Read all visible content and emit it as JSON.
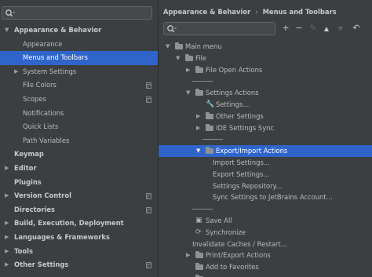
{
  "left": {
    "search": {
      "value": ""
    },
    "items": [
      {
        "label": "Appearance & Behavior",
        "bold": true,
        "arrow": "down"
      },
      {
        "label": "Appearance",
        "bold": false,
        "arrow": ""
      },
      {
        "label": "Menus and Toolbars",
        "bold": false,
        "arrow": "",
        "selected": true
      },
      {
        "label": "System Settings",
        "bold": false,
        "arrow": "right"
      },
      {
        "label": "File Colors",
        "bold": false,
        "arrow": "",
        "copy": true
      },
      {
        "label": "Scopes",
        "bold": false,
        "arrow": "",
        "copy": true
      },
      {
        "label": "Notifications",
        "bold": false,
        "arrow": ""
      },
      {
        "label": "Quick Lists",
        "bold": false,
        "arrow": ""
      },
      {
        "label": "Path Variables",
        "bold": false,
        "arrow": ""
      },
      {
        "label": "Keymap",
        "bold": true,
        "arrow": ""
      },
      {
        "label": "Editor",
        "bold": true,
        "arrow": "right"
      },
      {
        "label": "Plugins",
        "bold": true,
        "arrow": ""
      },
      {
        "label": "Version Control",
        "bold": true,
        "arrow": "right",
        "copy": true
      },
      {
        "label": "Directories",
        "bold": true,
        "arrow": "",
        "copy": true
      },
      {
        "label": "Build, Execution, Deployment",
        "bold": true,
        "arrow": "right"
      },
      {
        "label": "Languages & Frameworks",
        "bold": true,
        "arrow": "right"
      },
      {
        "label": "Tools",
        "bold": true,
        "arrow": "right"
      },
      {
        "label": "Other Settings",
        "bold": true,
        "arrow": "right",
        "copy": true
      }
    ]
  },
  "right": {
    "breadcrumb": [
      "Appearance & Behavior",
      "Menus and Toolbars"
    ],
    "search": {
      "value": ""
    },
    "toolbar": [
      {
        "name": "add-button",
        "glyph": "+",
        "enabled": true
      },
      {
        "name": "remove-button",
        "glyph": "−",
        "enabled": true
      },
      {
        "name": "edit-button",
        "glyph": "✎",
        "enabled": false
      },
      {
        "name": "move-up-button",
        "glyph": "▲",
        "enabled": true
      },
      {
        "name": "move-down-button",
        "glyph": "▼",
        "enabled": false
      },
      {
        "name": "restore-button",
        "glyph": "↶",
        "enabled": true
      }
    ],
    "tree": [
      {
        "label": "Main menu",
        "level": 0,
        "arrow": "down",
        "icon": "folder"
      },
      {
        "label": "File",
        "level": 1,
        "arrow": "down",
        "icon": "folder"
      },
      {
        "label": "File Open Actions",
        "level": 2,
        "arrow": "right",
        "icon": "folder"
      },
      {
        "label": "",
        "level": 2,
        "arrow": "",
        "icon": "separator"
      },
      {
        "label": "Settings Actions",
        "level": 2,
        "arrow": "down",
        "icon": "folder"
      },
      {
        "label": "Settings...",
        "level": 3,
        "arrow": "",
        "icon": "wrench"
      },
      {
        "label": "Other Settings",
        "level": 3,
        "arrow": "right",
        "icon": "folder"
      },
      {
        "label": "IDE Settings Sync",
        "level": 3,
        "arrow": "right",
        "icon": "folder"
      },
      {
        "label": "",
        "level": 3,
        "arrow": "",
        "icon": "separator"
      },
      {
        "label": "Export/Import Actions",
        "level": 3,
        "arrow": "down",
        "icon": "folder",
        "selected": true
      },
      {
        "label": "Import Settings...",
        "level": 4,
        "arrow": "",
        "icon": ""
      },
      {
        "label": "Export Settings...",
        "level": 4,
        "arrow": "",
        "icon": ""
      },
      {
        "label": "Settings Repository...",
        "level": 4,
        "arrow": "",
        "icon": ""
      },
      {
        "label": "Sync Settings to JetBrains Account...",
        "level": 4,
        "arrow": "",
        "icon": ""
      },
      {
        "label": "",
        "level": 2,
        "arrow": "",
        "icon": "separator"
      },
      {
        "label": "Save All",
        "level": 2,
        "arrow": "",
        "icon": "save"
      },
      {
        "label": "Synchronize",
        "level": 2,
        "arrow": "",
        "icon": "sync"
      },
      {
        "label": "Invalidate Caches / Restart...",
        "level": 2,
        "arrow": "",
        "icon": ""
      },
      {
        "label": "Print/Export Actions",
        "level": 2,
        "arrow": "right",
        "icon": "folder"
      },
      {
        "label": "Add to Favorites",
        "level": 2,
        "arrow": "",
        "icon": "folder"
      },
      {
        "label": "",
        "level": 2,
        "arrow": "",
        "icon": "folder"
      }
    ]
  },
  "colors": {
    "background": "#3c3f41",
    "selection": "#2f65ca",
    "text": "#bbbbbb"
  }
}
